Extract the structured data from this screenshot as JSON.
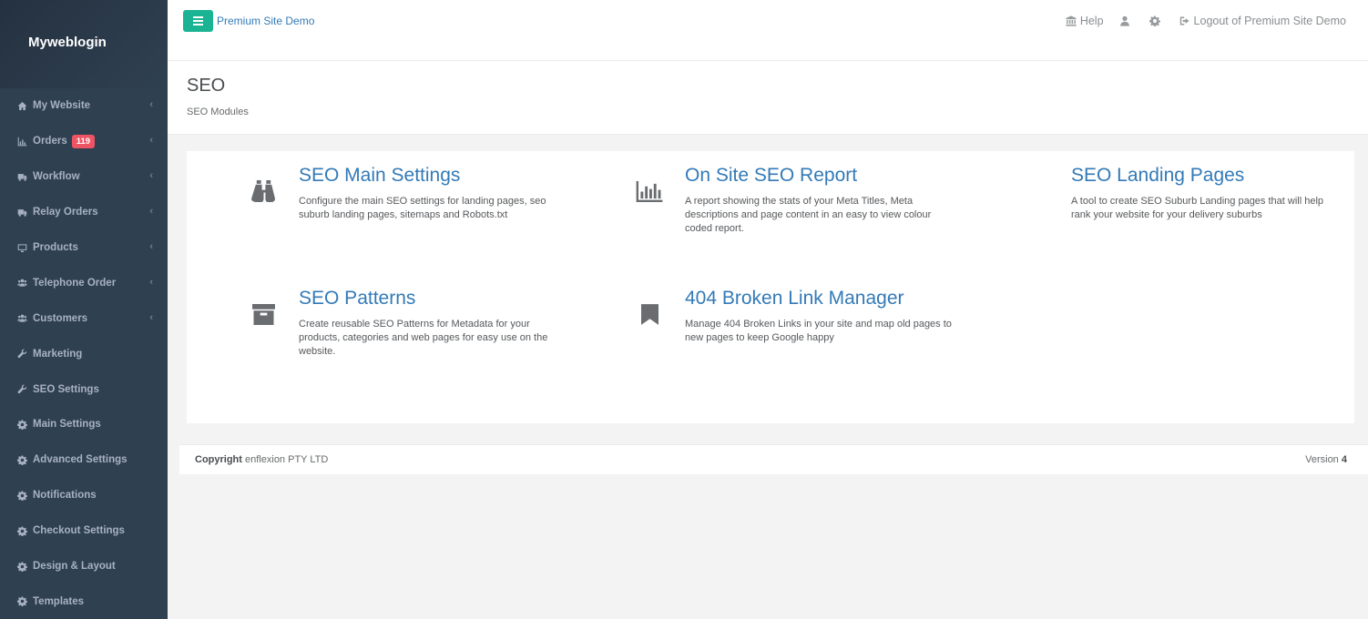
{
  "sidebar": {
    "brand": "Myweblogin",
    "items": [
      {
        "label": "My Website",
        "icon": "home-icon",
        "chevron": true
      },
      {
        "label": "Orders",
        "icon": "bar-chart-icon",
        "badge": "119",
        "chevron": true
      },
      {
        "label": "Workflow",
        "icon": "truck-icon",
        "chevron": true
      },
      {
        "label": "Relay Orders",
        "icon": "truck-icon",
        "chevron": true
      },
      {
        "label": "Products",
        "icon": "desktop-icon",
        "chevron": true
      },
      {
        "label": "Telephone Order",
        "icon": "users-icon",
        "chevron": true
      },
      {
        "label": "Customers",
        "icon": "users-icon",
        "chevron": true
      },
      {
        "label": "Marketing",
        "icon": "wrench-icon",
        "chevron": false
      },
      {
        "label": "SEO Settings",
        "icon": "wrench-icon",
        "chevron": false
      },
      {
        "label": "Main Settings",
        "icon": "gear-icon",
        "chevron": false
      },
      {
        "label": "Advanced Settings",
        "icon": "gear-icon",
        "chevron": false
      },
      {
        "label": "Notifications",
        "icon": "gear-icon",
        "chevron": false
      },
      {
        "label": "Checkout Settings",
        "icon": "gear-icon",
        "chevron": false
      },
      {
        "label": "Design & Layout",
        "icon": "gear-icon",
        "chevron": false
      },
      {
        "label": "Templates",
        "icon": "gear-icon",
        "chevron": false
      }
    ]
  },
  "topbar": {
    "site_name": "Premium Site Demo",
    "help": "Help",
    "logout": "Logout of Premium Site Demo"
  },
  "heading": {
    "title": "SEO",
    "subtitle": "SEO Modules"
  },
  "modules": [
    {
      "title": "SEO Main Settings",
      "icon": "binoculars-icon",
      "description": "Configure the main SEO settings for landing pages, seo suburb landing pages, sitemaps and Robots.txt"
    },
    {
      "title": "On Site SEO Report",
      "icon": "bar-chart-icon",
      "description": "A report showing the stats of your Meta Titles, Meta descriptions and page content in an easy to view colour coded report."
    },
    {
      "title": "SEO Landing Pages",
      "icon": "",
      "description": "A tool to create SEO Suburb Landing pages that will help rank your website for your delivery suburbs"
    },
    {
      "title": "SEO Patterns",
      "icon": "archive-icon",
      "description": "Create reusable SEO Patterns for Metadata for your products, categories and web pages for easy use on the website."
    },
    {
      "title": "404 Broken Link Manager",
      "icon": "bookmark-icon",
      "description": "Manage 404 Broken Links in your site and map old pages to new pages to keep Google happy"
    }
  ],
  "footer": {
    "copyright_label": "Copyright",
    "company": "enflexion PTY LTD",
    "version_label": "Version",
    "version": "4"
  },
  "glyphs": {
    "chevron": "‹"
  },
  "colors": {
    "sidebar": "#2f4050",
    "accent": "#1ab394",
    "link": "#337ab7",
    "badge": "#ed5565"
  }
}
